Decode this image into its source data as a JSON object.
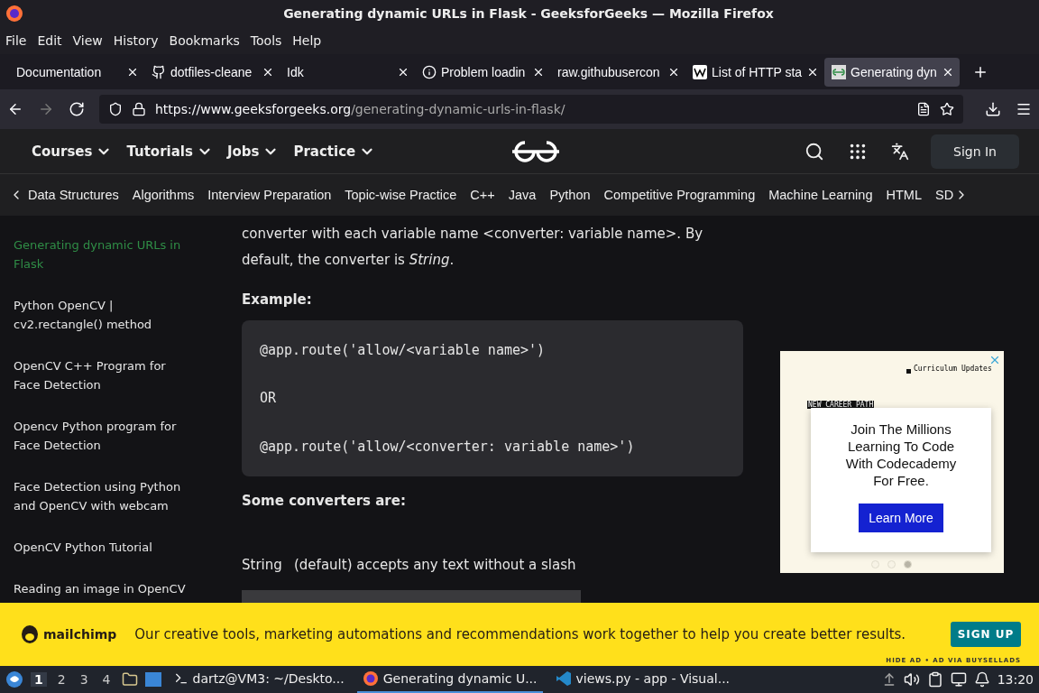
{
  "window": {
    "title": "Generating dynamic URLs in Flask - GeeksforGeeks — Mozilla Firefox"
  },
  "menu": [
    "File",
    "Edit",
    "View",
    "History",
    "Bookmarks",
    "Tools",
    "Help"
  ],
  "tabs": [
    {
      "label": "Documentation",
      "kind": "plain",
      "selected": false
    },
    {
      "label": "dotfiles-cleane",
      "kind": "github",
      "selected": false
    },
    {
      "label": "Idk",
      "kind": "plain",
      "selected": false
    },
    {
      "label": "Problem loadin",
      "kind": "info",
      "selected": false
    },
    {
      "label": "raw.githubusercon",
      "kind": "plain",
      "selected": false
    },
    {
      "label": "List of HTTP sta",
      "kind": "wiki",
      "selected": false
    },
    {
      "label": "Generating dyn",
      "kind": "site",
      "selected": true
    }
  ],
  "address": {
    "host": "https://www.geeksforgeeks.org",
    "path": "/generating-dynamic-urls-in-flask/"
  },
  "site_nav": [
    "Courses",
    "Tutorials",
    "Jobs",
    "Practice"
  ],
  "sign_in": "Sign In",
  "categories": [
    "Data Structures",
    "Algorithms",
    "Interview Preparation",
    "Topic-wise Practice",
    "C++",
    "Java",
    "Python",
    "Competitive Programming",
    "Machine Learning",
    "HTML",
    "SD"
  ],
  "sidebar": [
    {
      "label": "Generating dynamic URLs in Flask",
      "selected": true
    },
    {
      "label": "Python OpenCV | cv2.rectangle() method",
      "selected": false
    },
    {
      "label": "OpenCV C++ Program for Face Detection",
      "selected": false
    },
    {
      "label": "Opencv Python program for Face Detection",
      "selected": false
    },
    {
      "label": "Face Detection using Python and OpenCV with webcam",
      "selected": false
    },
    {
      "label": "OpenCV Python Tutorial",
      "selected": false
    },
    {
      "label": "Reading an image in OpenCV",
      "selected": false
    }
  ],
  "article": {
    "intro": "converter with each variable name <converter: variable name>. By default, the converter is *String*.",
    "example_heading": "Example:",
    "code": [
      "@app.route('allow/<variable name>')",
      "OR",
      "@app.route('allow/<converter: variable name>')"
    ],
    "converters_heading": "Some converters are:",
    "converters": [
      {
        "name": "String",
        "text": "(default) accepts any text without a slash"
      }
    ]
  },
  "ad": {
    "tag": "Curriculum Updates",
    "label": "NEW CAREER PATH",
    "headline": "Join The Millions Learning To Code With Codecademy For Free.",
    "button": "Learn More",
    "dots": [
      {
        "selected": false
      },
      {
        "selected": false
      },
      {
        "selected": true
      }
    ]
  },
  "banner": {
    "brand": "mailchimp",
    "text": "Our creative tools, marketing automations and recommendations work together to help you create better results.",
    "button": "SIGN UP",
    "footer": "HIDE AD • AD VIA BUYSELLADS"
  },
  "taskbar": {
    "workspaces": [
      {
        "label": "1",
        "selected": true
      },
      {
        "label": "2",
        "selected": false
      },
      {
        "label": "3",
        "selected": false
      },
      {
        "label": "4",
        "selected": false
      }
    ],
    "tasks": [
      {
        "label": "dartz@VM3: ~/Deskto...",
        "kind": "terminal",
        "selected": false
      },
      {
        "label": "Generating dynamic U...",
        "kind": "browser",
        "selected": true
      },
      {
        "label": "views.py - app - Visual...",
        "kind": "editor",
        "selected": false
      }
    ],
    "clock": "13:20"
  }
}
